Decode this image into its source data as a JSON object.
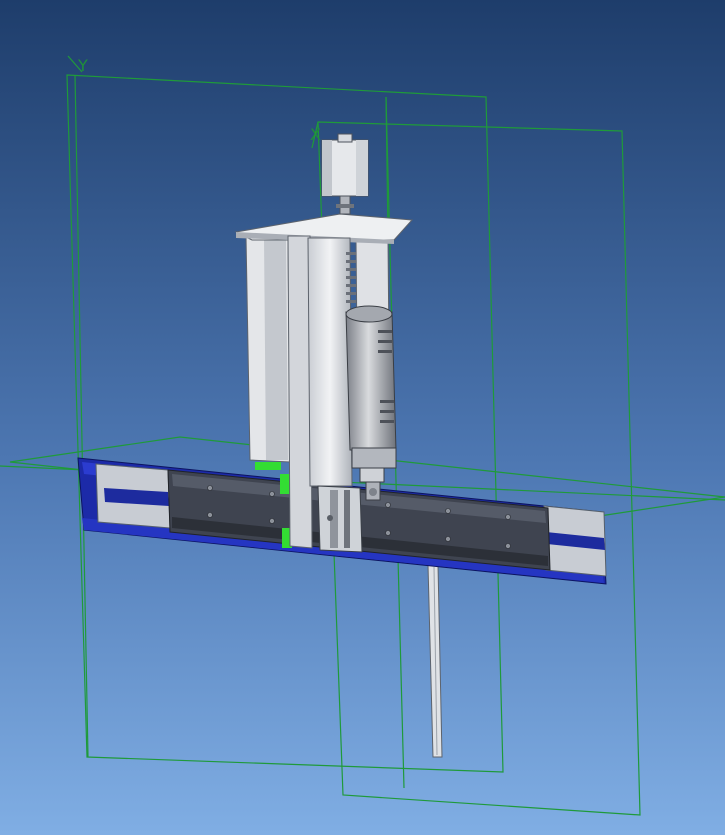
{
  "viewport": {
    "background_top": "#1e3d6b",
    "background_bottom": "#7ea9df",
    "plane_color": "#1f9a3a",
    "rail_blue": "#1c2aa8",
    "carriage_dark": "#3f4450",
    "metal_light": "#e3e5e8",
    "metal_mid": "#b9bec5",
    "highlight_green": "#33dd33"
  },
  "axes": {
    "y_label": "Y",
    "x_label": "X"
  },
  "icons": {
    "rail": "linear-rail",
    "carriage": "carriage-plate",
    "column": "vertical-column",
    "motor": "stepper-motor",
    "spindle": "spindle-motor",
    "tool": "tool-bit"
  }
}
